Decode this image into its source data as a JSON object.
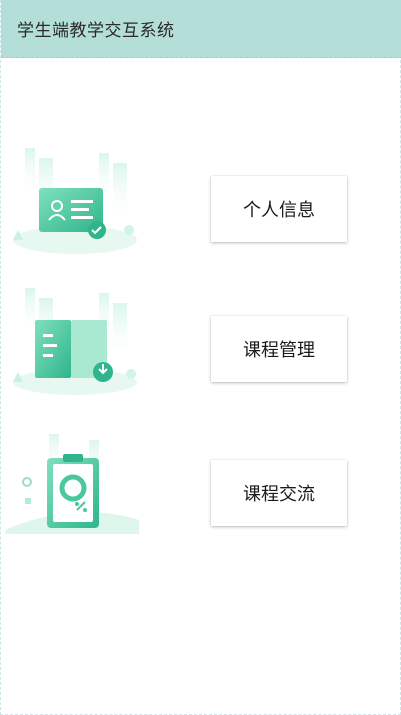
{
  "app": {
    "title": "学生端教学交互系统"
  },
  "menu": [
    {
      "label": "个人信息",
      "icon": "id-card-check-icon"
    },
    {
      "label": "课程管理",
      "icon": "book-download-icon"
    },
    {
      "label": "课程交流",
      "icon": "clipboard-chart-icon"
    }
  ],
  "colors": {
    "header_bg": "#b4dfd8",
    "accent": "#3fc09a",
    "accent_light": "#c9f0e2"
  }
}
